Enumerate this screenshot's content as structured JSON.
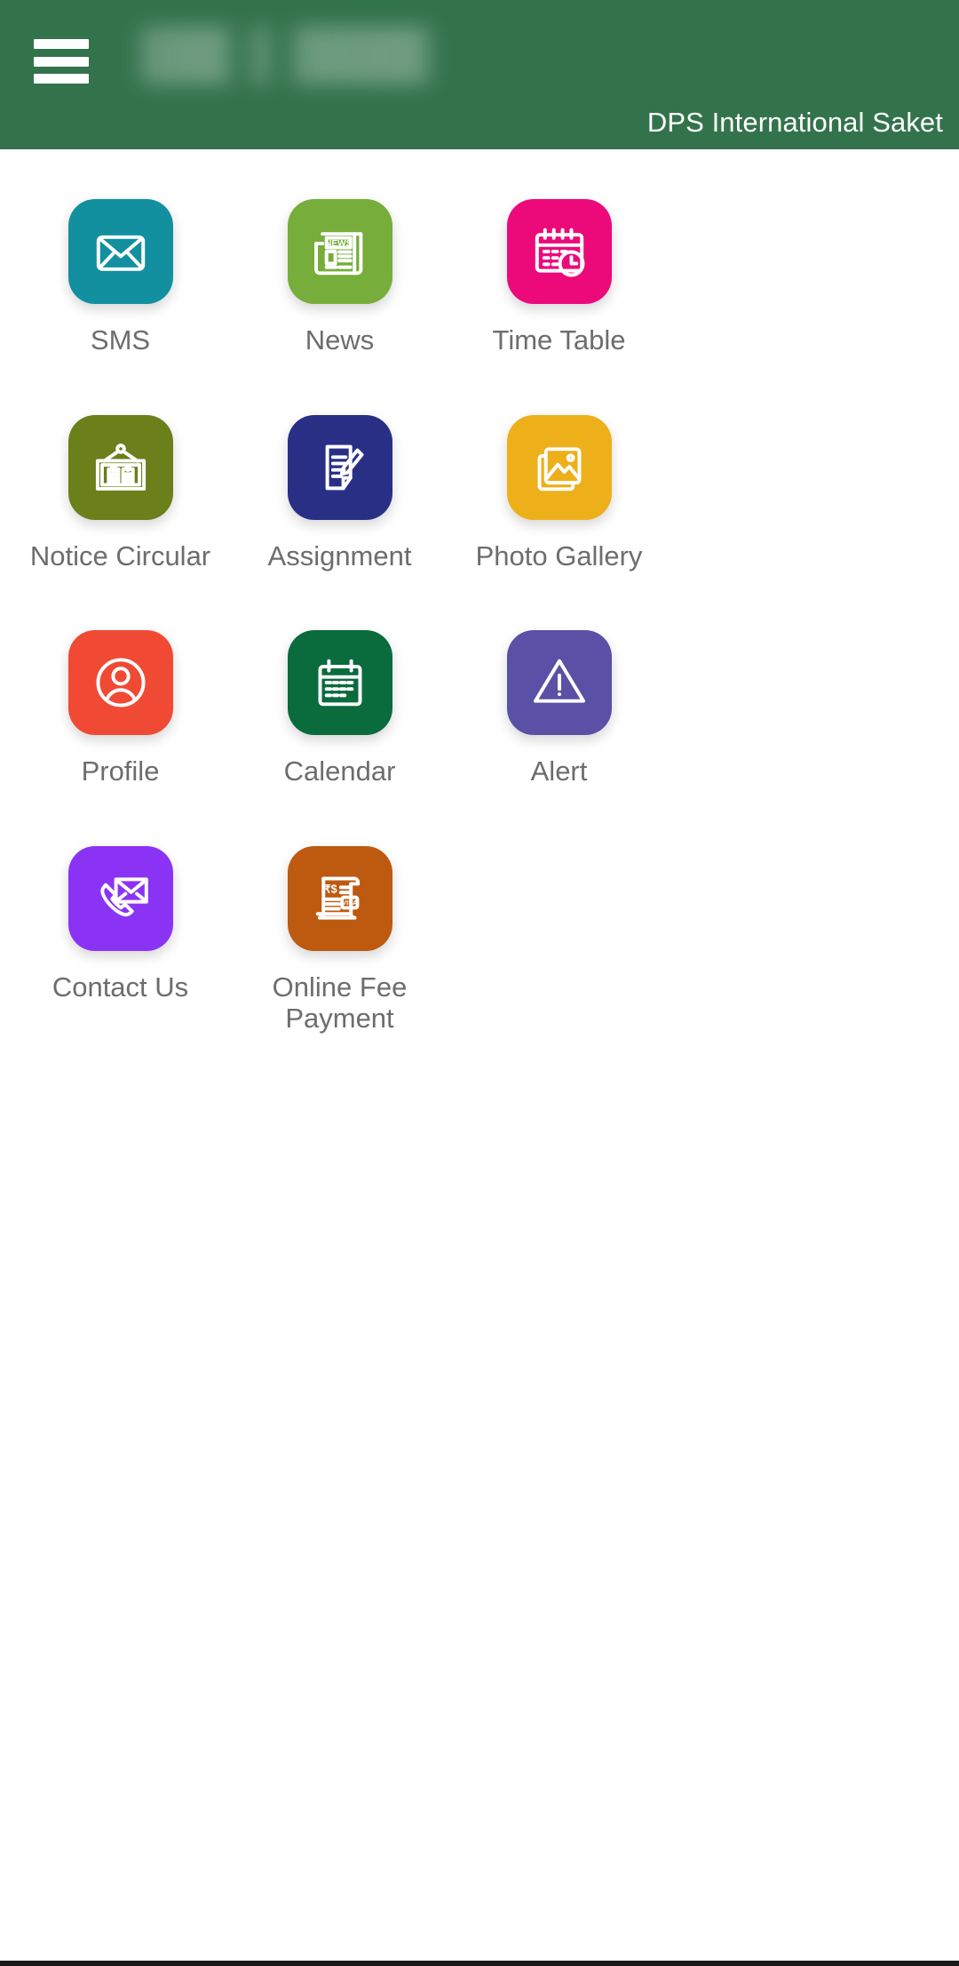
{
  "header": {
    "menu_icon": "hamburger-menu-icon",
    "title_redacted": "",
    "school_name": "DPS International Saket",
    "background_color": "#33734C",
    "text_color": "#FFFFFF"
  },
  "grid": {
    "columns": 3,
    "items": [
      {
        "label": "SMS",
        "icon": "envelope-icon",
        "color": "#1290A0"
      },
      {
        "label": "News",
        "icon": "newspaper-icon",
        "color": "#76AD3B"
      },
      {
        "label": "Time Table",
        "icon": "calendar-clock-icon",
        "color": "#EC0A7B"
      },
      {
        "label": "Notice Circular",
        "icon": "notice-board-icon",
        "color": "#6B7F1B"
      },
      {
        "label": "Assignment",
        "icon": "document-pen-icon",
        "color": "#2A2F86"
      },
      {
        "label": "Photo Gallery",
        "icon": "photo-stack-icon",
        "color": "#EDB01A"
      },
      {
        "label": "Profile",
        "icon": "user-circle-icon",
        "color": "#F04A35"
      },
      {
        "label": "Calendar",
        "icon": "calendar-grid-icon",
        "color": "#0A6B3C"
      },
      {
        "label": "Alert",
        "icon": "warning-triangle-icon",
        "color": "#5A50A5"
      },
      {
        "label": "Contact Us",
        "icon": "phone-envelope-icon",
        "color": "#8B33F5"
      },
      {
        "label": "Online Fee Payment",
        "icon": "invoice-visa-icon",
        "color": "#BD5A10"
      }
    ]
  },
  "newspaper_masthead": "NEWS",
  "invoice_card_label": "VISA",
  "invoice_currency": "₹$"
}
